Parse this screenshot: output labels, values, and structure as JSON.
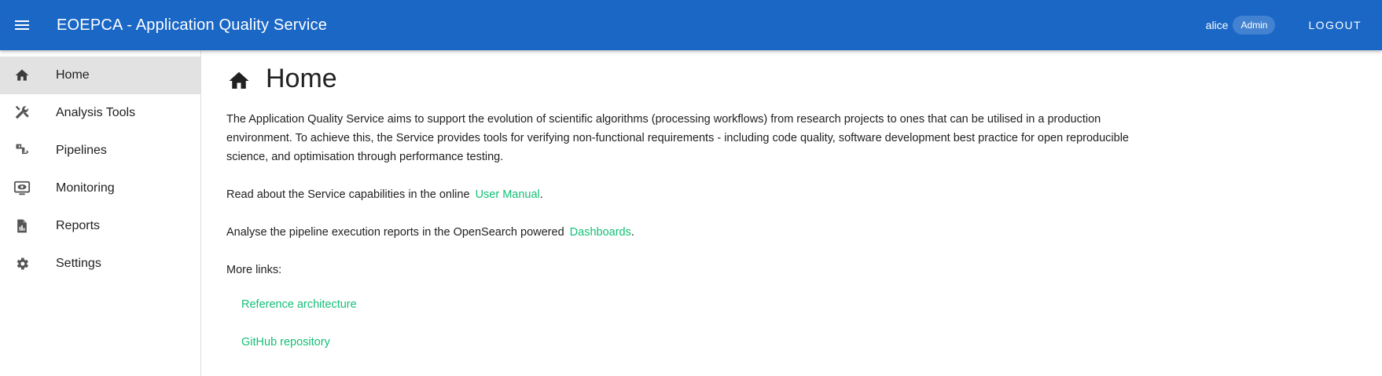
{
  "app": {
    "title": "EOEPCA - Application Quality Service",
    "menu_icon": "menu-icon",
    "bar_color": "#1a67c6"
  },
  "user": {
    "name": "alice",
    "role": "Admin",
    "logout_label": "LOGOUT"
  },
  "sidebar": {
    "items": [
      {
        "label": "Home",
        "icon": "home-icon",
        "active": true
      },
      {
        "label": "Analysis Tools",
        "icon": "tools-icon",
        "active": false
      },
      {
        "label": "Pipelines",
        "icon": "pipeline-icon",
        "active": false
      },
      {
        "label": "Monitoring",
        "icon": "monitor-eye-icon",
        "active": false
      },
      {
        "label": "Reports",
        "icon": "report-file-icon",
        "active": false
      },
      {
        "label": "Settings",
        "icon": "gear-icon",
        "active": false
      }
    ]
  },
  "main": {
    "title": "Home",
    "title_icon": "home-icon",
    "intro": "The Application Quality Service aims to support the evolution of scientific algorithms (processing workflows) from research projects to ones that can be utilised in a production environment. To achieve this, the Service provides tools for verifying non-functional requirements - including code quality, software development best practice for open reproducible science, and optimisation through performance testing.",
    "manual_prefix": "Read about the Service capabilities in the online",
    "manual_link": "User Manual",
    "manual_suffix": ".",
    "dash_prefix": "Analyse the pipeline execution reports in the OpenSearch powered",
    "dash_link": "Dashboards",
    "dash_suffix": ".",
    "more_links_label": "More links:",
    "more_links": [
      "Reference architecture",
      "GitHub repository"
    ],
    "link_color": "#13bf75"
  }
}
